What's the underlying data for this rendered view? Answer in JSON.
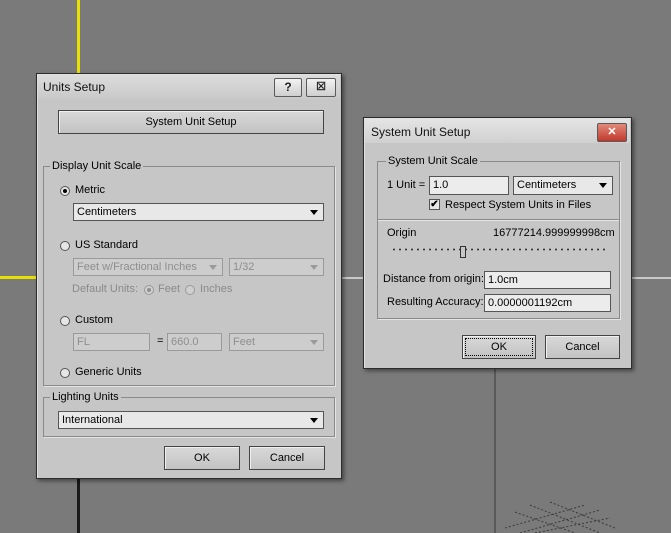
{
  "units_setup": {
    "title": "Units Setup",
    "help_label": "?",
    "close_label": "☒",
    "system_unit_setup_button": "System Unit Setup",
    "display_unit_scale": {
      "label": "Display Unit Scale",
      "metric_label": "Metric",
      "metric_selected": true,
      "metric_value": "Centimeters",
      "us_standard_label": "US Standard",
      "us_value": "Feet w/Fractional Inches",
      "us_fraction": "1/32",
      "default_units_label": "Default Units:",
      "feet_label": "Feet",
      "inches_label": "Inches",
      "custom_label": "Custom",
      "custom_name": "FL",
      "equals": "=",
      "custom_value": "660.0",
      "custom_unit": "Feet",
      "generic_label": "Generic Units"
    },
    "lighting_units": {
      "label": "Lighting Units",
      "value": "International"
    },
    "ok_label": "OK",
    "cancel_label": "Cancel"
  },
  "system_unit_setup": {
    "title": "System Unit Setup",
    "close_label": "✕",
    "scale_group_label": "System Unit Scale",
    "one_unit_label": "1 Unit =",
    "one_unit_value": "1.0",
    "unit_value": "Centimeters",
    "respect_label": "Respect System Units in Files",
    "respect_checked": true,
    "check_mark": "✔",
    "origin_label": "Origin",
    "origin_value": "16777214.999999998cm",
    "slider_position": 0.33,
    "distance_label": "Distance from origin:",
    "distance_value": "1.0cm",
    "accuracy_label": "Resulting Accuracy:",
    "accuracy_value": "0.0000001192cm",
    "ok_label": "OK",
    "cancel_label": "Cancel"
  }
}
